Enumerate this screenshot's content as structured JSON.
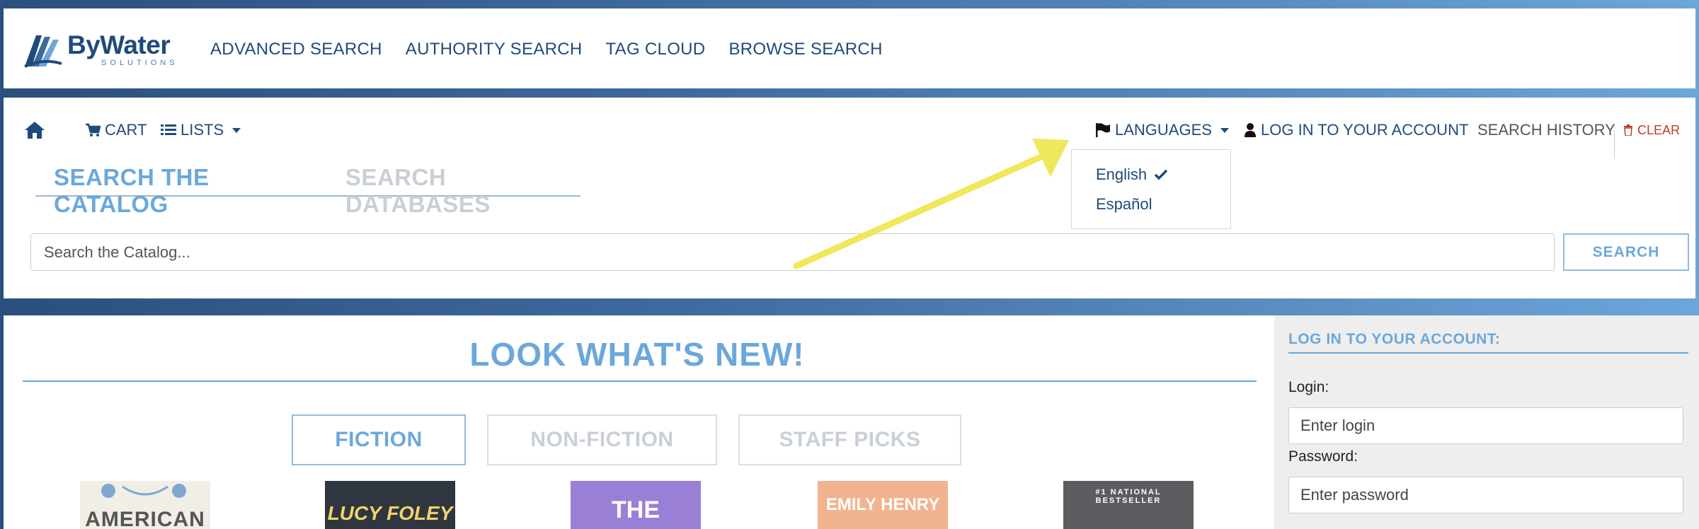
{
  "brand": {
    "name": "ByWater",
    "tagline": "SOLUTIONS"
  },
  "top_nav": [
    {
      "label": "ADVANCED SEARCH"
    },
    {
      "label": "AUTHORITY SEARCH"
    },
    {
      "label": "TAG CLOUD"
    },
    {
      "label": "BROWSE SEARCH"
    }
  ],
  "navbar": {
    "home_icon": "home-icon",
    "cart": "CART",
    "lists": "LISTS",
    "languages": "LANGUAGES",
    "login": "LOG IN TO YOUR ACCOUNT",
    "search_history": "SEARCH HISTORY",
    "clear": "CLEAR"
  },
  "languages_menu": [
    {
      "label": "English",
      "selected": true
    },
    {
      "label": "Español",
      "selected": false
    }
  ],
  "search_tabs": {
    "catalog": "SEARCH THE CATALOG",
    "databases": "SEARCH DATABASES"
  },
  "search": {
    "placeholder": "Search the Catalog...",
    "button": "SEARCH"
  },
  "whats_new": {
    "title": "LOOK WHAT'S NEW!",
    "categories": [
      "FICTION",
      "NON-FICTION",
      "STAFF PICKS"
    ],
    "active_category": "FICTION",
    "covers": [
      {
        "text": "AMERICAN",
        "bg": "#f1eee6"
      },
      {
        "text": "LUCY FOLEY",
        "bg": "#2f3640"
      },
      {
        "text": "THE",
        "bg": "#9a7fd6"
      },
      {
        "text": "EMILY HENRY",
        "bg": "#f2b390"
      },
      {
        "text": "#1 NATIONAL BESTSELLER",
        "bg": "#5c5d60"
      }
    ]
  },
  "login_panel": {
    "title": "LOG IN TO YOUR ACCOUNT:",
    "login_label": "Login:",
    "login_placeholder": "Enter login",
    "password_label": "Password:",
    "password_placeholder": "Enter password"
  },
  "colors": {
    "accent": "#6aa8dc",
    "brand": "#1f4a7c",
    "annotation_arrow": "#eee85a",
    "clear": "#c0392b"
  }
}
